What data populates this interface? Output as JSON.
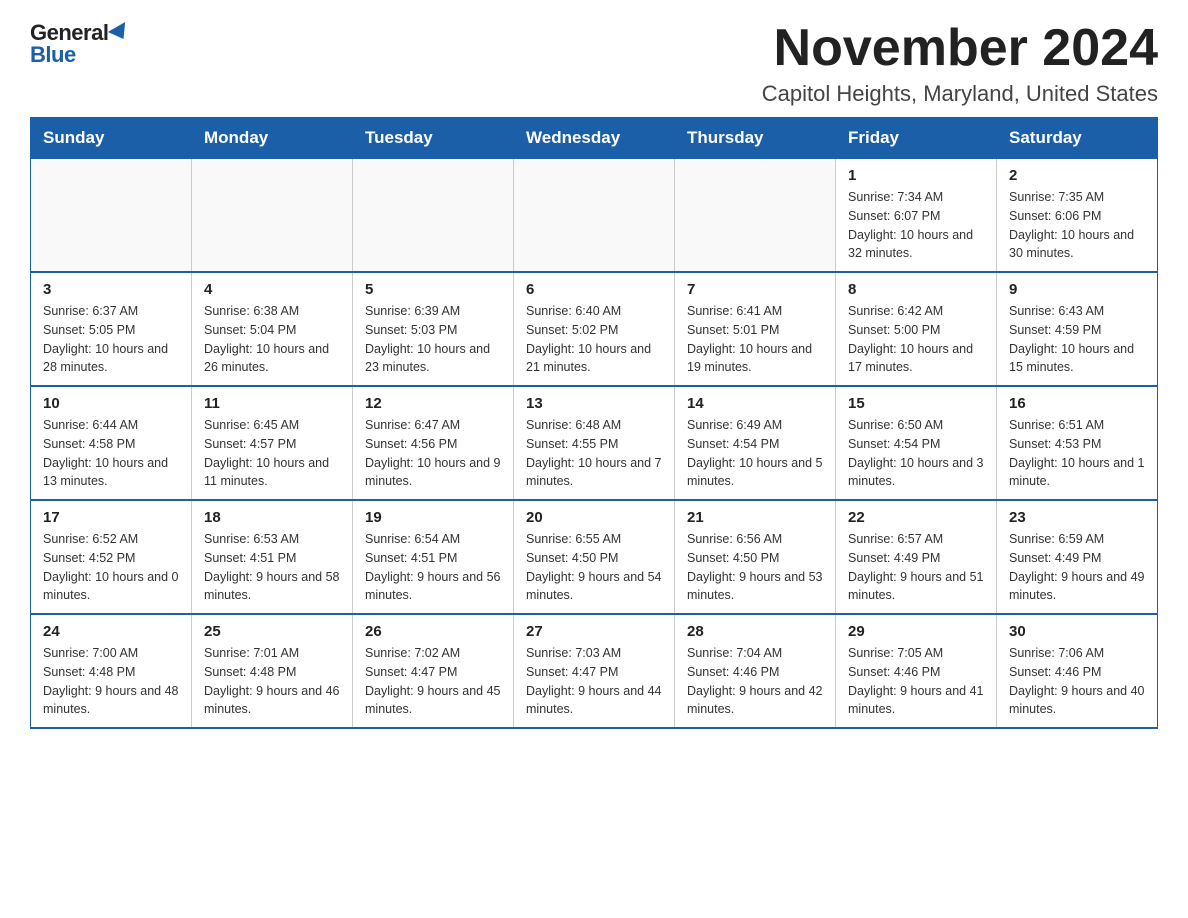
{
  "logo": {
    "general": "General",
    "blue": "Blue"
  },
  "title": "November 2024",
  "location": "Capitol Heights, Maryland, United States",
  "days_of_week": [
    "Sunday",
    "Monday",
    "Tuesday",
    "Wednesday",
    "Thursday",
    "Friday",
    "Saturday"
  ],
  "weeks": [
    [
      {
        "day": "",
        "info": ""
      },
      {
        "day": "",
        "info": ""
      },
      {
        "day": "",
        "info": ""
      },
      {
        "day": "",
        "info": ""
      },
      {
        "day": "",
        "info": ""
      },
      {
        "day": "1",
        "info": "Sunrise: 7:34 AM\nSunset: 6:07 PM\nDaylight: 10 hours and 32 minutes."
      },
      {
        "day": "2",
        "info": "Sunrise: 7:35 AM\nSunset: 6:06 PM\nDaylight: 10 hours and 30 minutes."
      }
    ],
    [
      {
        "day": "3",
        "info": "Sunrise: 6:37 AM\nSunset: 5:05 PM\nDaylight: 10 hours and 28 minutes."
      },
      {
        "day": "4",
        "info": "Sunrise: 6:38 AM\nSunset: 5:04 PM\nDaylight: 10 hours and 26 minutes."
      },
      {
        "day": "5",
        "info": "Sunrise: 6:39 AM\nSunset: 5:03 PM\nDaylight: 10 hours and 23 minutes."
      },
      {
        "day": "6",
        "info": "Sunrise: 6:40 AM\nSunset: 5:02 PM\nDaylight: 10 hours and 21 minutes."
      },
      {
        "day": "7",
        "info": "Sunrise: 6:41 AM\nSunset: 5:01 PM\nDaylight: 10 hours and 19 minutes."
      },
      {
        "day": "8",
        "info": "Sunrise: 6:42 AM\nSunset: 5:00 PM\nDaylight: 10 hours and 17 minutes."
      },
      {
        "day": "9",
        "info": "Sunrise: 6:43 AM\nSunset: 4:59 PM\nDaylight: 10 hours and 15 minutes."
      }
    ],
    [
      {
        "day": "10",
        "info": "Sunrise: 6:44 AM\nSunset: 4:58 PM\nDaylight: 10 hours and 13 minutes."
      },
      {
        "day": "11",
        "info": "Sunrise: 6:45 AM\nSunset: 4:57 PM\nDaylight: 10 hours and 11 minutes."
      },
      {
        "day": "12",
        "info": "Sunrise: 6:47 AM\nSunset: 4:56 PM\nDaylight: 10 hours and 9 minutes."
      },
      {
        "day": "13",
        "info": "Sunrise: 6:48 AM\nSunset: 4:55 PM\nDaylight: 10 hours and 7 minutes."
      },
      {
        "day": "14",
        "info": "Sunrise: 6:49 AM\nSunset: 4:54 PM\nDaylight: 10 hours and 5 minutes."
      },
      {
        "day": "15",
        "info": "Sunrise: 6:50 AM\nSunset: 4:54 PM\nDaylight: 10 hours and 3 minutes."
      },
      {
        "day": "16",
        "info": "Sunrise: 6:51 AM\nSunset: 4:53 PM\nDaylight: 10 hours and 1 minute."
      }
    ],
    [
      {
        "day": "17",
        "info": "Sunrise: 6:52 AM\nSunset: 4:52 PM\nDaylight: 10 hours and 0 minutes."
      },
      {
        "day": "18",
        "info": "Sunrise: 6:53 AM\nSunset: 4:51 PM\nDaylight: 9 hours and 58 minutes."
      },
      {
        "day": "19",
        "info": "Sunrise: 6:54 AM\nSunset: 4:51 PM\nDaylight: 9 hours and 56 minutes."
      },
      {
        "day": "20",
        "info": "Sunrise: 6:55 AM\nSunset: 4:50 PM\nDaylight: 9 hours and 54 minutes."
      },
      {
        "day": "21",
        "info": "Sunrise: 6:56 AM\nSunset: 4:50 PM\nDaylight: 9 hours and 53 minutes."
      },
      {
        "day": "22",
        "info": "Sunrise: 6:57 AM\nSunset: 4:49 PM\nDaylight: 9 hours and 51 minutes."
      },
      {
        "day": "23",
        "info": "Sunrise: 6:59 AM\nSunset: 4:49 PM\nDaylight: 9 hours and 49 minutes."
      }
    ],
    [
      {
        "day": "24",
        "info": "Sunrise: 7:00 AM\nSunset: 4:48 PM\nDaylight: 9 hours and 48 minutes."
      },
      {
        "day": "25",
        "info": "Sunrise: 7:01 AM\nSunset: 4:48 PM\nDaylight: 9 hours and 46 minutes."
      },
      {
        "day": "26",
        "info": "Sunrise: 7:02 AM\nSunset: 4:47 PM\nDaylight: 9 hours and 45 minutes."
      },
      {
        "day": "27",
        "info": "Sunrise: 7:03 AM\nSunset: 4:47 PM\nDaylight: 9 hours and 44 minutes."
      },
      {
        "day": "28",
        "info": "Sunrise: 7:04 AM\nSunset: 4:46 PM\nDaylight: 9 hours and 42 minutes."
      },
      {
        "day": "29",
        "info": "Sunrise: 7:05 AM\nSunset: 4:46 PM\nDaylight: 9 hours and 41 minutes."
      },
      {
        "day": "30",
        "info": "Sunrise: 7:06 AM\nSunset: 4:46 PM\nDaylight: 9 hours and 40 minutes."
      }
    ]
  ]
}
